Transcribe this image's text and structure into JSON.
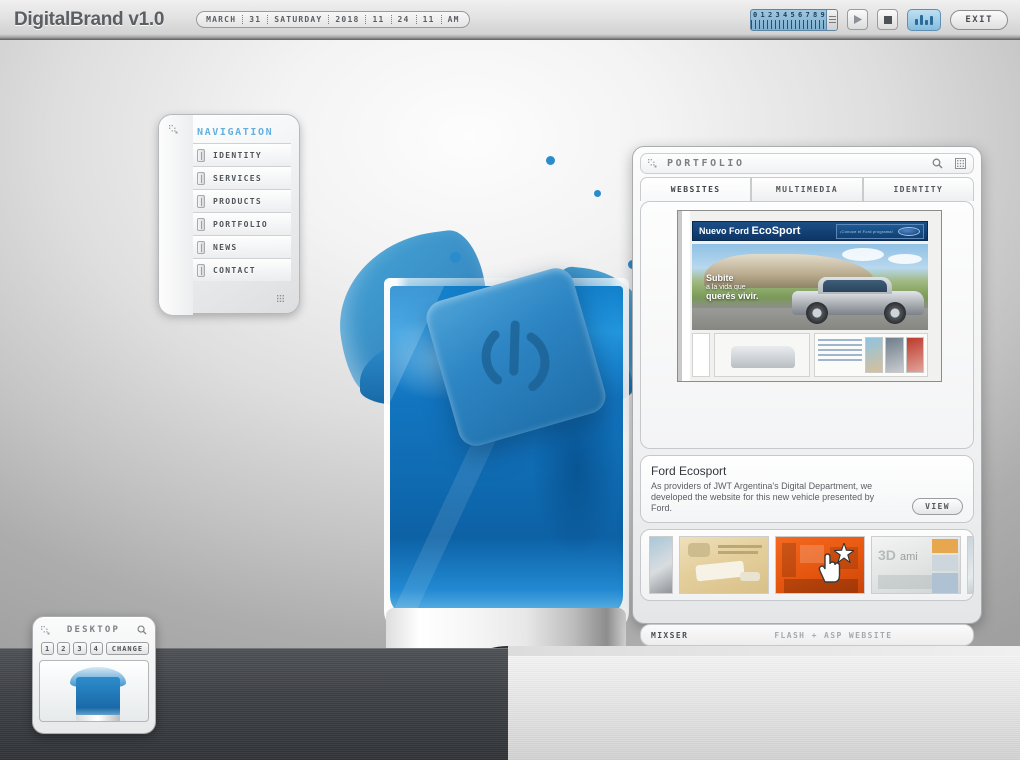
{
  "app": {
    "brand": "DigitalBrand v1.0",
    "accent_blue": "#63b0e0",
    "water_blue": "#2d8ccb"
  },
  "topbar": {
    "datetime": {
      "month": "MARCH",
      "day": "31",
      "weekday": "SATURDAY",
      "year": "2018",
      "hour": "11",
      "minute": "24",
      "second": "11",
      "meridiem": "AM"
    },
    "ruler": {
      "digits": [
        "0",
        "1",
        "2",
        "3",
        "4",
        "5",
        "6",
        "7",
        "8",
        "9"
      ]
    },
    "controls": {
      "play_icon": "play-icon",
      "stop_icon": "stop-icon",
      "equalizer_icon": "equalizer-icon",
      "exit_label": "EXIT"
    }
  },
  "navigation": {
    "title": "NAVIGATION",
    "resize_icon": "resize-handle-icon",
    "grip_icon": "grip-dots-icon",
    "items": [
      {
        "label": "IDENTITY",
        "icon": "pill-icon"
      },
      {
        "label": "SERVICES",
        "icon": "pill-icon"
      },
      {
        "label": "PRODUCTS",
        "icon": "pill-icon"
      },
      {
        "label": "PORTFOLIO",
        "icon": "pill-icon"
      },
      {
        "label": "NEWS",
        "icon": "pill-icon"
      },
      {
        "label": "CONTACT",
        "icon": "pill-icon"
      }
    ]
  },
  "portfolio": {
    "title": "PORTFOLIO",
    "resize_icon": "resize-handle-icon",
    "zoom_icon": "magnifier-icon",
    "close_icon": "grid-dots-icon",
    "tabs": [
      {
        "label": "WEBSITES",
        "active": true
      },
      {
        "label": "MULTIMEDIA",
        "active": false
      },
      {
        "label": "IDENTITY",
        "active": false
      }
    ],
    "preview": {
      "site_brand_prefix": "Nuevo Ford",
      "site_brand_name": "EcoSport",
      "site_banner_text": "¡Conoce el Ford programa!",
      "hero_line1": "Subite",
      "hero_line2": "a la vida que",
      "hero_line3": "querés vivir.",
      "feature_lines": [
        "MOTOR 1.6 / 2.0",
        "CAJA MANUAL",
        "EQUIPAMIENTO",
        "SEGURIDAD",
        "ACCESORIOS"
      ]
    },
    "detail": {
      "title": "Ford Ecosport",
      "description": "As providers of JWT Argentina's Digital Department, we developed the website for this new vehicle presented by Ford.",
      "view_label": "VIEW"
    },
    "thumbnails": [
      {
        "name": "thumb-partial-left",
        "kind": "partial"
      },
      {
        "name": "thumb-bubba",
        "kind": "full"
      },
      {
        "name": "thumb-orange-office",
        "kind": "full"
      },
      {
        "name": "thumb-3d-mall",
        "kind": "full"
      },
      {
        "name": "thumb-partial-right",
        "kind": "partial"
      }
    ],
    "status": {
      "left": "MIXSER",
      "center": "FLASH + ASP WEBSITE"
    }
  },
  "desktop_widget": {
    "title": "DESKTOP",
    "resize_icon": "resize-handle-icon",
    "zoom_icon": "magnifier-icon",
    "buttons": [
      "1",
      "2",
      "3",
      "4"
    ],
    "change_label": "CHANGE",
    "preview_name": "water-splash-wallpaper"
  }
}
